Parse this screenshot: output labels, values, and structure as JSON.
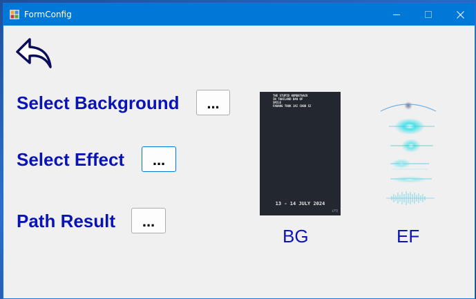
{
  "window": {
    "title": "FormConfig",
    "app_icon": "form-app-icon"
  },
  "titlebar": {
    "minimize_icon": "minimize-icon",
    "maximize_icon": "maximize-icon",
    "close_icon": "close-icon"
  },
  "back": {
    "icon": "back-arrow-icon"
  },
  "rows": [
    {
      "label": "Select Background",
      "button_label": "..."
    },
    {
      "label": "Select Effect",
      "button_label": "..."
    },
    {
      "label": "Path Result",
      "button_label": "..."
    }
  ],
  "preview_bg": {
    "text": "THE STUPID HOMBATHACK\nIN THAILAND DAN OF\nSMILE\nFARANG TOOK JAI CHOB SI",
    "date": "13 - 14 JULY 2024",
    "logo": "iFQ",
    "caption": "BG"
  },
  "preview_ef": {
    "caption": "EF"
  },
  "colors": {
    "titlebar": "#0078d7",
    "label_text": "#0a14b4",
    "window_bg": "#f0f0f0"
  }
}
